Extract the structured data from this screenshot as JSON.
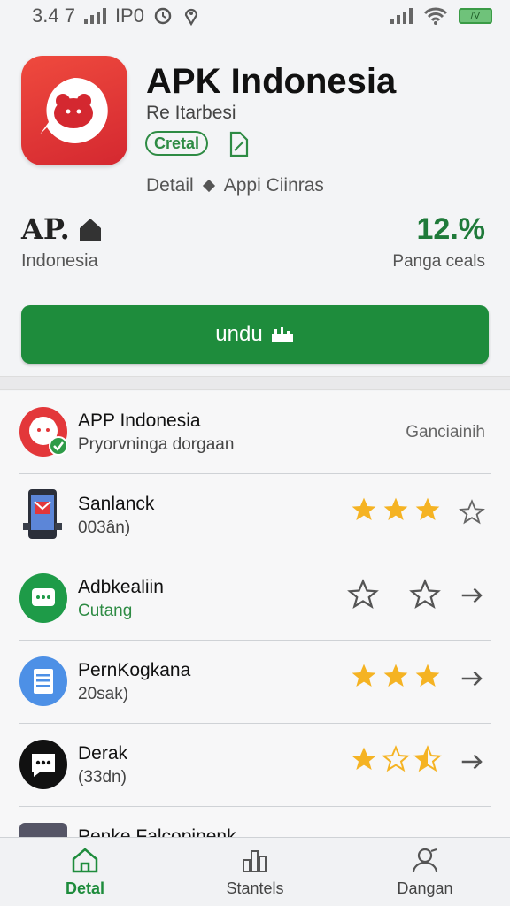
{
  "status_bar": {
    "time": "3.4 7",
    "carrier": "IP0"
  },
  "app": {
    "title": "APK Indonesia",
    "subtitle": "Re Itarbesi",
    "category_badge": "Cretal",
    "meta_left": "Detail",
    "meta_right": "Appi Ciinras",
    "icon_color": "#e3373a"
  },
  "stats": {
    "left_value": "AP.",
    "left_label": "Indonesia",
    "right_value": "12.%",
    "right_label": "Panga ceals"
  },
  "download_button": {
    "label": "undu"
  },
  "list_items": [
    {
      "title": "APP Indonesia",
      "subtitle": "Pryorvninga dorgaan",
      "right_text": "Ganciainih",
      "icon": "red-app-icon"
    },
    {
      "title": "Sanlanck",
      "subtitle": "003ân)",
      "stars_filled": 3,
      "stars_total": 4,
      "icon": "phone-icon",
      "end_icon": "star-outline-icon"
    },
    {
      "title": "Adbkealiin",
      "subtitle": "Cutang",
      "stars_filled": 0,
      "stars_total": 2,
      "icon": "chat-green-icon",
      "end_icon": "arrow-right-icon"
    },
    {
      "title": "PernKogkana",
      "subtitle": "20sak)",
      "stars_filled": 3,
      "stars_total": 3,
      "icon": "doc-blue-icon",
      "end_icon": "arrow-right-icon"
    },
    {
      "title": "Derak",
      "subtitle": "(33dn)",
      "stars_filled": 1.5,
      "stars_total": 3,
      "icon": "chat-black-icon",
      "end_icon": "arrow-right-icon"
    },
    {
      "title": "Penke Falcopinenk",
      "subtitle": "",
      "icon": "photo-icon"
    }
  ],
  "bottom_nav": [
    {
      "label": "Detal",
      "icon": "home-icon",
      "active": true
    },
    {
      "label": "Stantels",
      "icon": "chart-icon",
      "active": false
    },
    {
      "label": "Dangan",
      "icon": "user-icon",
      "active": false
    }
  ],
  "colors": {
    "primary_green": "#1e8c3c",
    "star_gold": "#f5b323",
    "accent_red": "#e3373a"
  }
}
